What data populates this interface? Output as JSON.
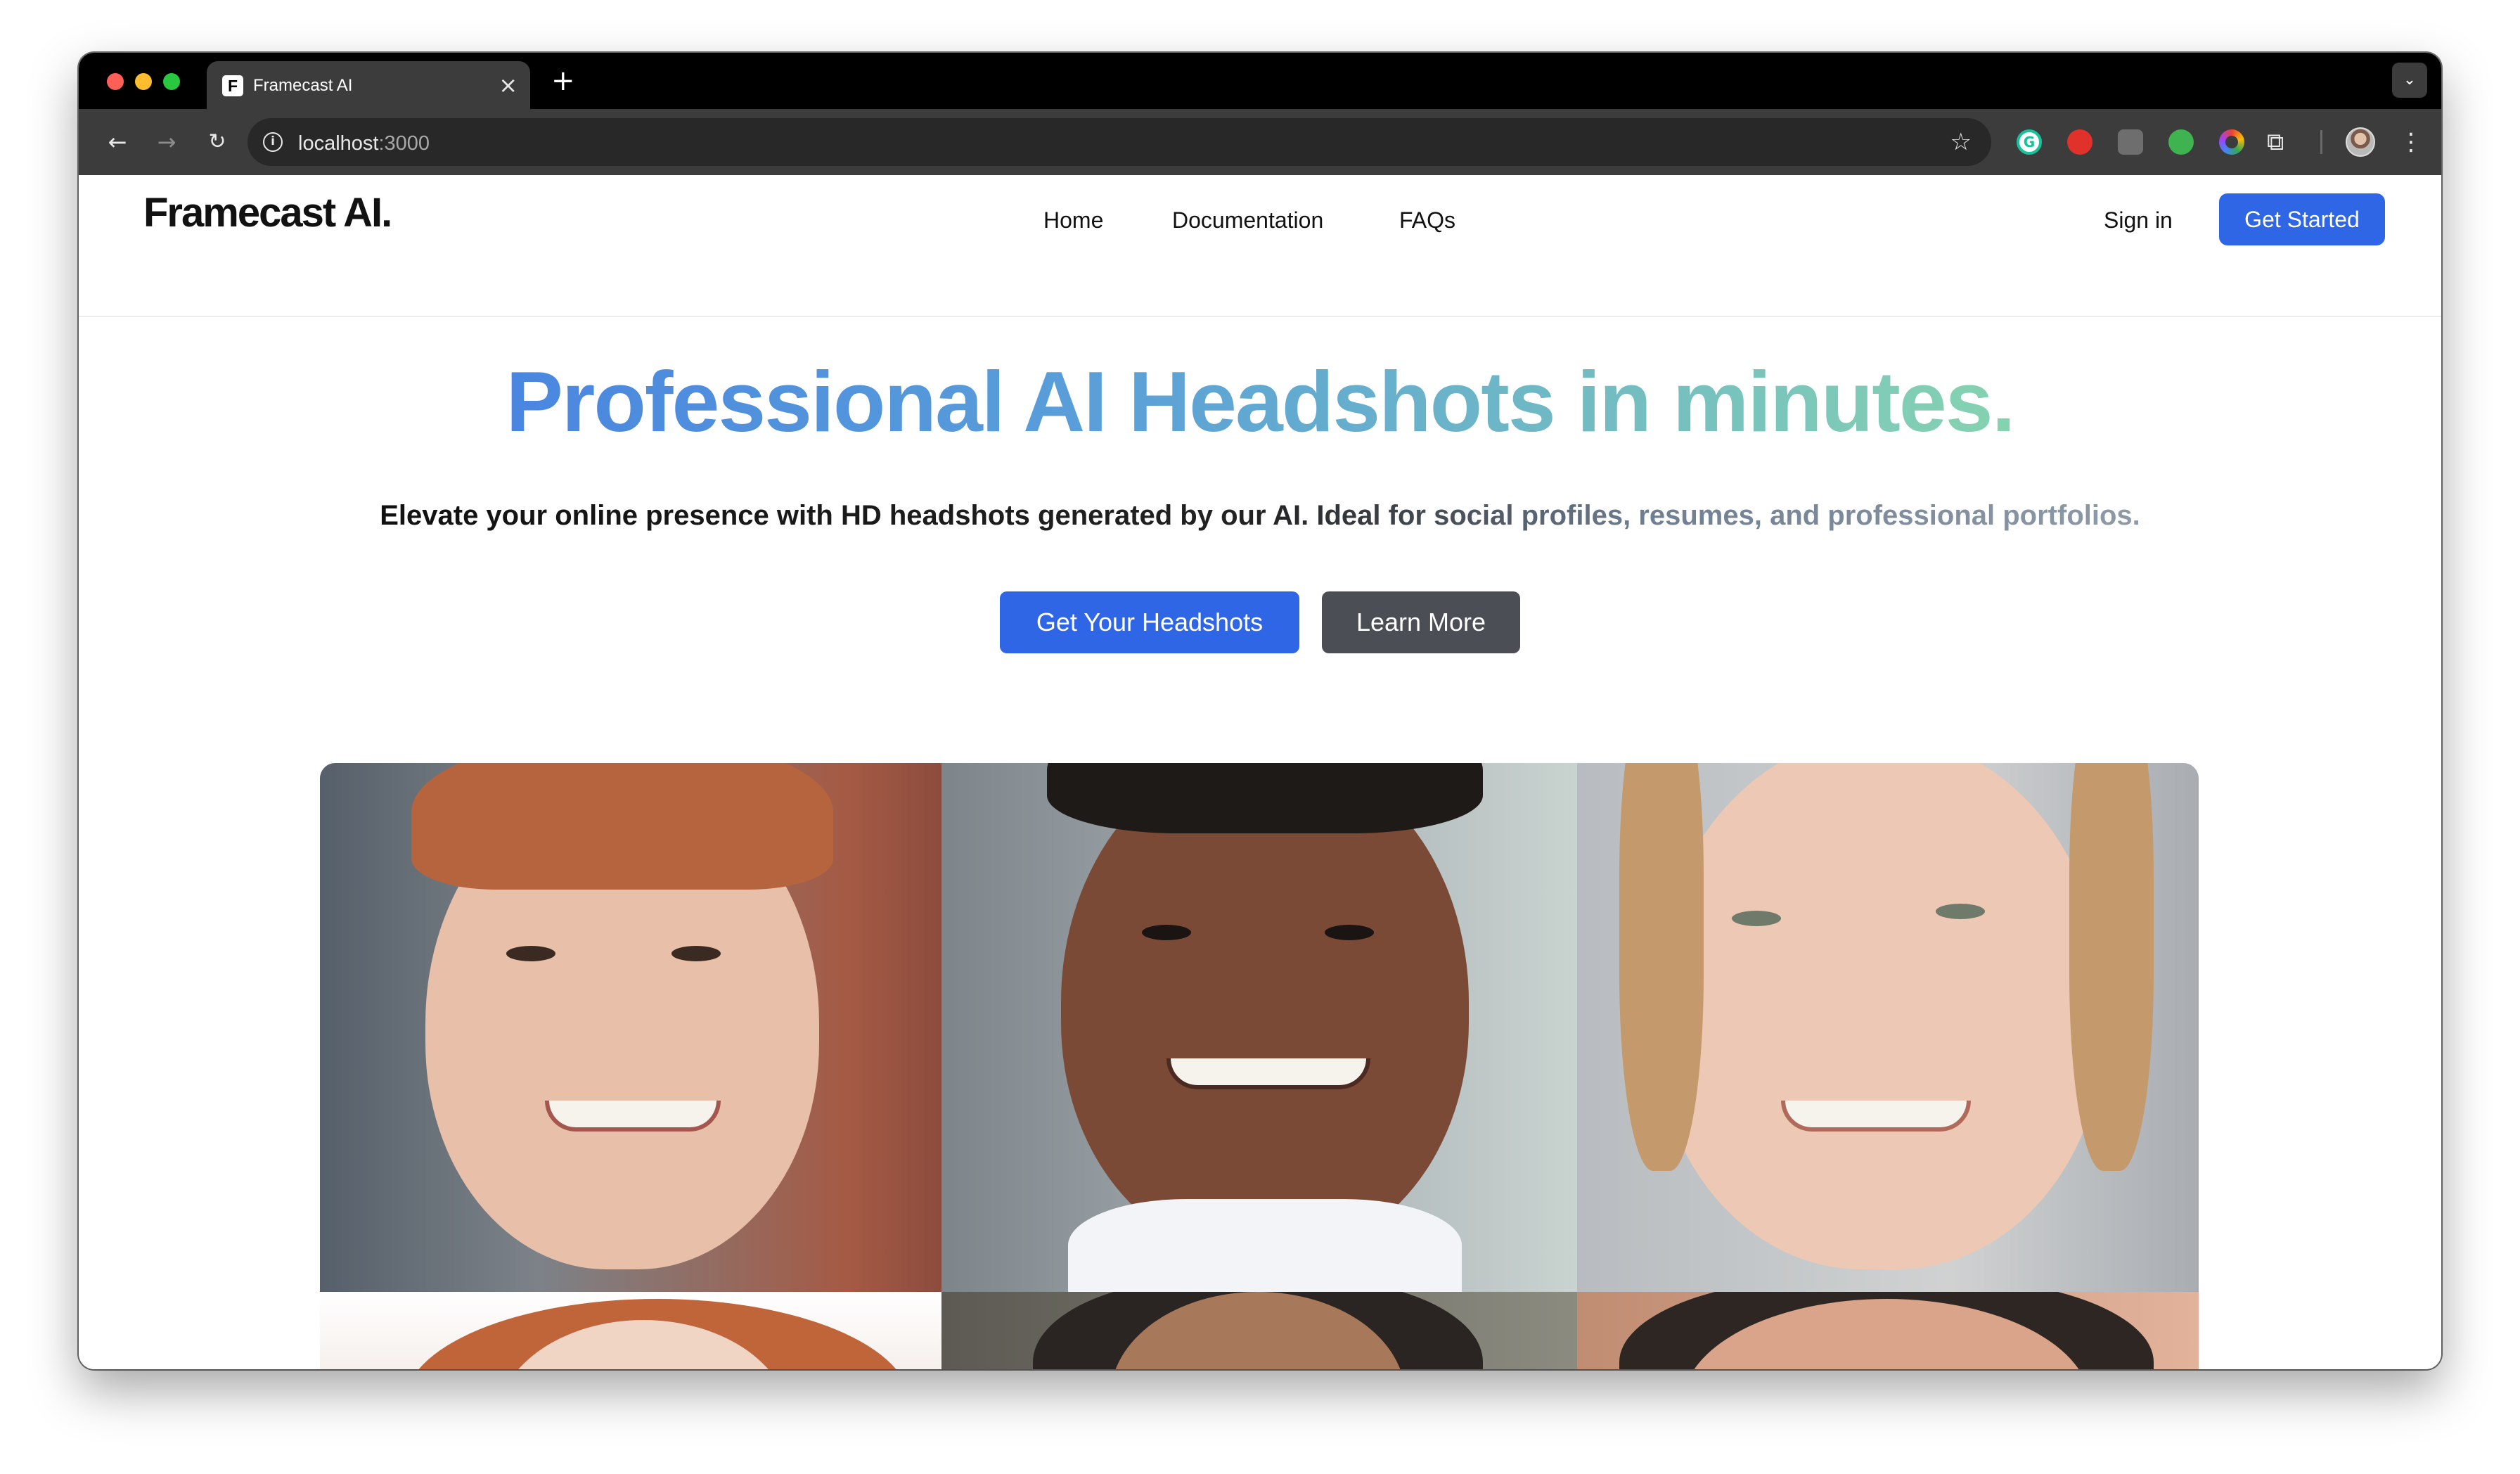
{
  "browser": {
    "tab_title": "Framecast AI",
    "tab_favicon_letter": "F",
    "tab_close_glyph": "×",
    "new_tab_glyph": "+",
    "url_host": "localhost",
    "url_port": ":3000",
    "icons": [
      "back-icon",
      "forward-icon",
      "reload-icon",
      "info-icon",
      "star-icon",
      "grammarly-icon",
      "extension-icon",
      "puzzle-icon",
      "profile-avatar",
      "menu-icon",
      "tab-search-icon"
    ]
  },
  "header": {
    "logo": "Framecast AI.",
    "nav": [
      "Home",
      "Documentation",
      "FAQs"
    ],
    "sign_in": "Sign in",
    "get_started": "Get Started"
  },
  "hero": {
    "title": "Professional AI Headshots in minutes.",
    "subtitle": "Elevate your online presence with HD headshots generated by our AI. Ideal for social profiles, resumes, and professional portfolios.",
    "cta_primary": "Get Your Headshots",
    "cta_secondary": "Learn More"
  },
  "colors": {
    "accent_blue": "#2f66e6",
    "secondary_button": "#4b4e55",
    "title_gradient_start": "#4a86e0",
    "title_gradient_end": "#86d3b0"
  }
}
